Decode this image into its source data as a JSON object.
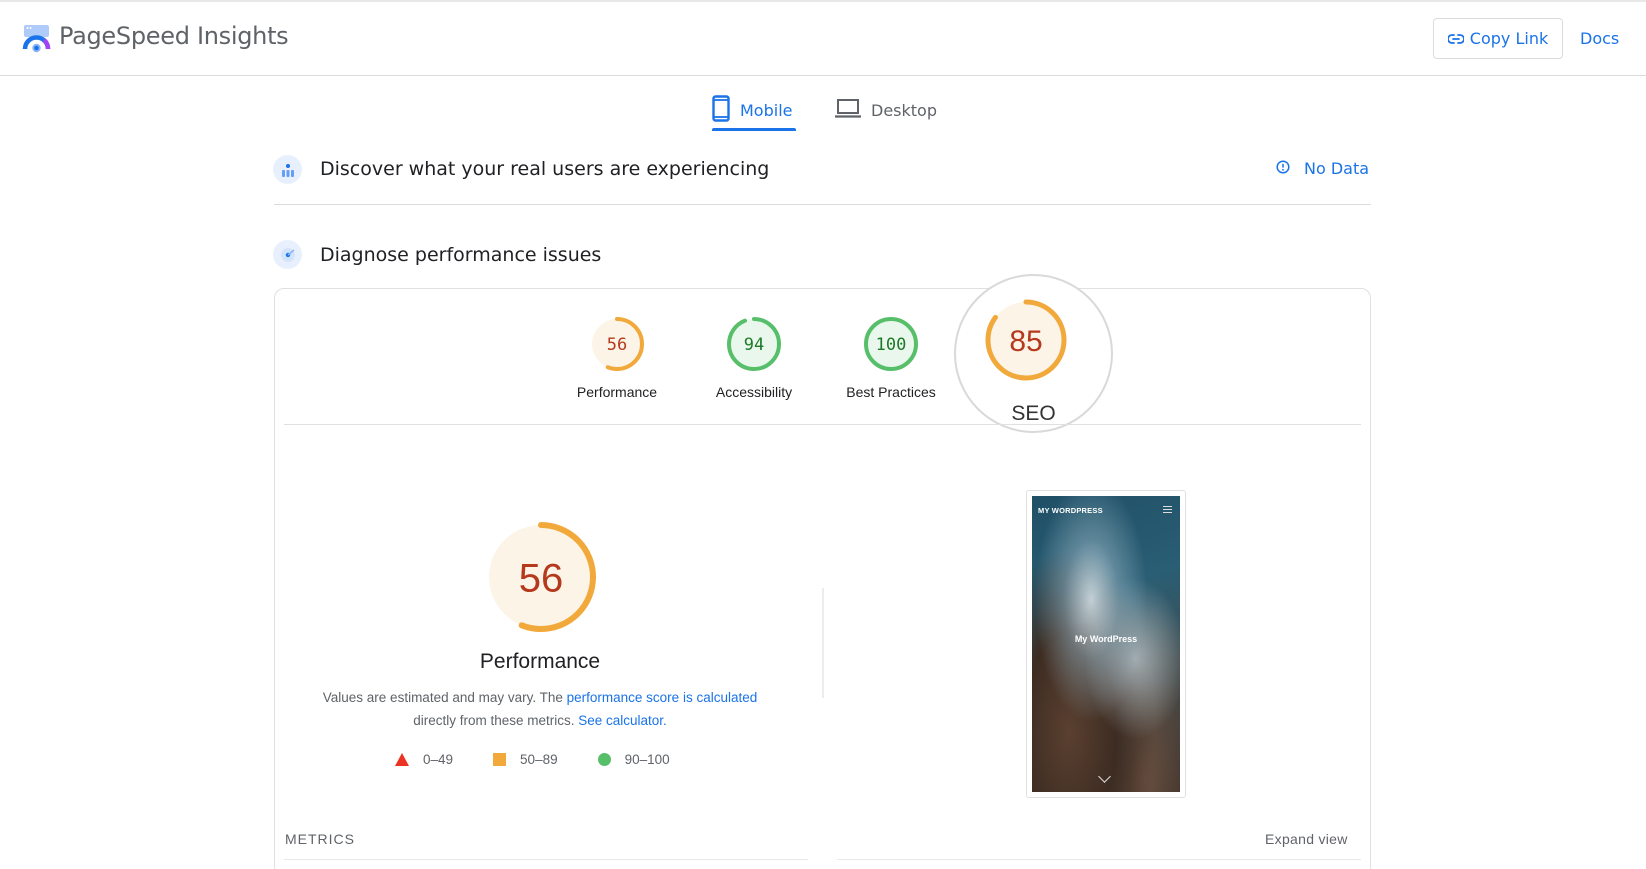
{
  "header": {
    "app_title": "PageSpeed Insights",
    "copy_link_label": "Copy Link",
    "docs_label": "Docs"
  },
  "tabs": [
    {
      "label": "Mobile",
      "icon": "smartphone-icon",
      "active": true
    },
    {
      "label": "Desktop",
      "icon": "laptop-icon",
      "active": false
    }
  ],
  "field_data": {
    "title": "Discover what your real users are experiencing",
    "status_label": "No Data",
    "status_icon": "info-icon"
  },
  "lab_data": {
    "title": "Diagnose performance issues"
  },
  "categories": [
    {
      "label": "Performance",
      "score": 56,
      "rating": "average"
    },
    {
      "label": "Accessibility",
      "score": 94,
      "rating": "pass"
    },
    {
      "label": "Best Practices",
      "score": 100,
      "rating": "pass"
    },
    {
      "label": "SEO",
      "score": 85,
      "rating": "average",
      "highlighted": true
    }
  ],
  "performance": {
    "score": 56,
    "label": "Performance",
    "description_prefix": "Values are estimated and may vary. The ",
    "description_link": "performance score is calculated",
    "description_middle": " directly from these metrics. ",
    "calculator_link": "See calculator.",
    "legend": [
      {
        "shape": "triangle",
        "range": "0–49",
        "color": "#eb3323"
      },
      {
        "shape": "square",
        "range": "50–89",
        "color": "#f2a93b"
      },
      {
        "shape": "circle",
        "range": "90–100",
        "color": "#57bf6a"
      }
    ]
  },
  "screenshot": {
    "site_brand": "MY WORDPRESS",
    "site_title": "My WordPress"
  },
  "metrics": {
    "heading": "METRICS",
    "expand_label": "Expand view"
  },
  "colors": {
    "accent": "#1a73e8",
    "pass": "#0cce6b",
    "pass_ring": "#57bf6a",
    "pass_text": "#1e7a28",
    "pass_bg": "#e9f7ec",
    "average_ring": "#f2a93b",
    "average_text": "#b5391c",
    "average_bg": "#fdf4e8"
  }
}
